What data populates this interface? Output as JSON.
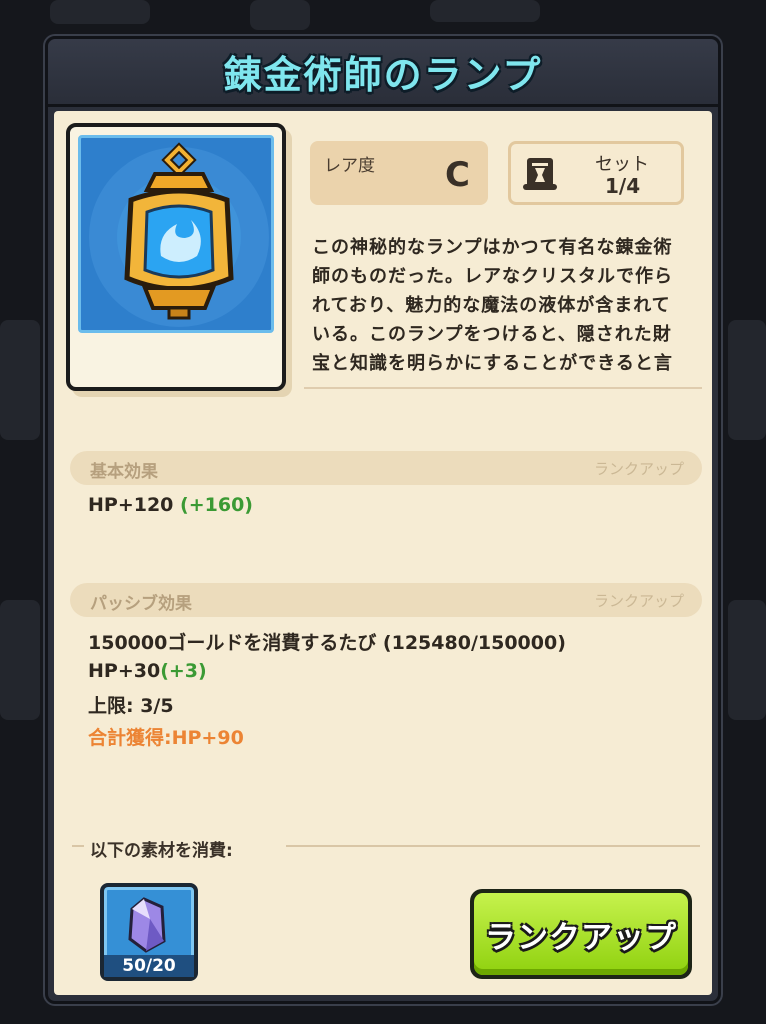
{
  "dialog": {
    "title": "錬金術師のランプ"
  },
  "item": {
    "icon": "alchemist-lamp",
    "rarity_label": "レア度",
    "rarity_value": "C",
    "set_label": "セット",
    "set_value": "1/4",
    "description": "この神秘的なランプはかつて有名な錬金術師のものだった。レアなクリスタルで作られており、魅力的な魔法の液体が含まれている。このランプをつけると、隠された財宝と知識を明らかにすることができると言われている。"
  },
  "basic_effect": {
    "title": "基本効果",
    "action": "ランクアップ",
    "value": "HP+120",
    "bonus": "(+160)"
  },
  "passive_effect": {
    "title": "パッシブ効果",
    "action": "ランクアップ",
    "condition": "150000ゴールドを消費するたび (125480/150000)",
    "value": "HP+30",
    "bonus": "(+3)",
    "limit": "上限: 3/5",
    "total": "合計獲得:HP+90"
  },
  "consume": {
    "label": "以下の素材を消費:",
    "material_icon": "crystal-shard",
    "material_count": "50/20"
  },
  "button": {
    "rankup_label": "ランクアップ"
  },
  "colors": {
    "title": "#7fe6ee",
    "bonus": "#3b9a34",
    "total": "#ec8434",
    "button": "#a8e22a"
  }
}
